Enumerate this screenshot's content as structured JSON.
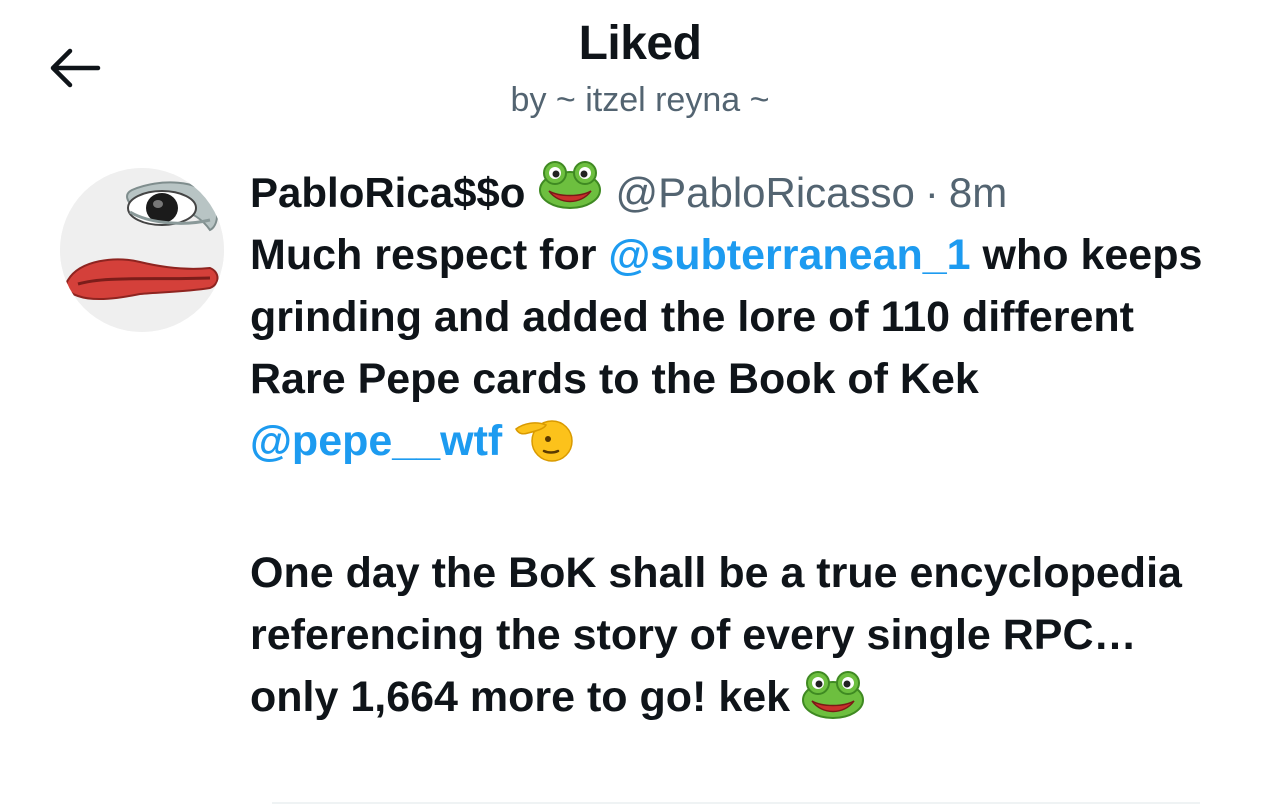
{
  "header": {
    "title": "Liked",
    "subtitle": "by ~ itzel reyna ~",
    "back_icon": "arrow-left-icon"
  },
  "tweet": {
    "display_name": "PabloRica$$o",
    "name_emoji": "frog-face-icon",
    "handle": "@PabloRicasso",
    "separator": "·",
    "time": "8m",
    "more_icon": "more-horizontal-icon",
    "text": {
      "p1_a": "Much respect for ",
      "mention_1": "@subterranean_1",
      "p1_b": " who keeps grinding and added the lore of 110 different Rare Pepe cards to the Book of Kek ",
      "mention_2": "@pepe__wtf",
      "p1_emoji": "saluting-face-icon",
      "p2": "One day the BoK shall be a true encyclopedia referencing the story of every single RPC… only 1,664 more to go! kek",
      "p2_emoji": "frog-face-icon"
    }
  },
  "colors": {
    "text": "#0f1419",
    "secondary": "#536471",
    "link": "#1d9bf0",
    "divider": "#eff3f4"
  }
}
